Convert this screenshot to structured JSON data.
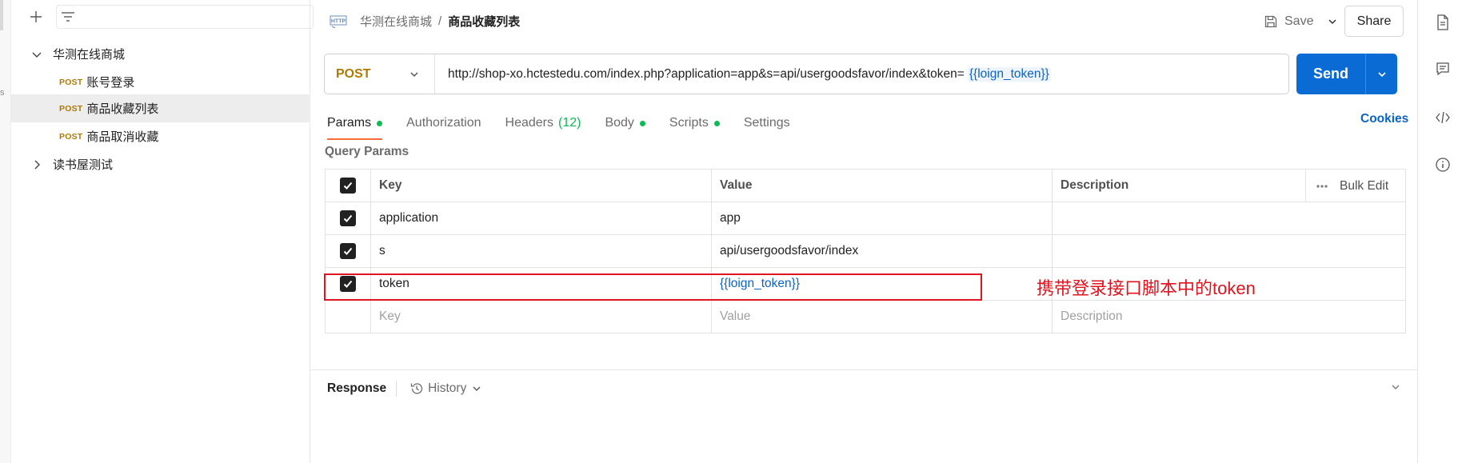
{
  "edge": {
    "mark": "s"
  },
  "sidebar": {
    "collections": [
      {
        "label": "华测在线商城",
        "expanded": true
      },
      {
        "label": "读书屋测试",
        "expanded": false
      }
    ],
    "requests": [
      {
        "method": "POST",
        "label": "账号登录"
      },
      {
        "method": "POST",
        "label": "商品收藏列表"
      },
      {
        "method": "POST",
        "label": "商品取消收藏"
      }
    ]
  },
  "header": {
    "breadcrumb_parent": "华测在线商城",
    "breadcrumb_sep": "/",
    "breadcrumb_current": "商品收藏列表",
    "save_label": "Save",
    "share_label": "Share"
  },
  "request": {
    "method": "POST",
    "url_base": "http://shop-xo.hctestedu.com/index.php?application=app&s=api/usergoodsfavor/index&token=",
    "url_var": "{{loign_token}}",
    "send_label": "Send"
  },
  "tabs": {
    "params": "Params",
    "authorization": "Authorization",
    "headers": "Headers",
    "headers_count": "(12)",
    "body": "Body",
    "scripts": "Scripts",
    "settings": "Settings",
    "cookies": "Cookies"
  },
  "query_params": {
    "title": "Query Params",
    "headers": {
      "key": "Key",
      "value": "Value",
      "description": "Description",
      "bulk_edit": "Bulk Edit"
    },
    "rows": [
      {
        "key": "application",
        "value": "app",
        "description": ""
      },
      {
        "key": "s",
        "value": "api/usergoodsfavor/index",
        "description": ""
      },
      {
        "key": "token",
        "value": "{{loign_token}}",
        "description": ""
      }
    ],
    "placeholder": {
      "key": "Key",
      "value": "Value",
      "description": "Description"
    }
  },
  "annotation": {
    "text": "携带登录接口脚本中的token",
    "color": "#e0141e"
  },
  "response": {
    "label": "Response",
    "history": "History"
  },
  "colors": {
    "accent": "#ff6c37",
    "send": "#0b6bd4",
    "method_post": "#ad7a03",
    "dot": "#0cbb52",
    "link": "#0b63c5"
  }
}
